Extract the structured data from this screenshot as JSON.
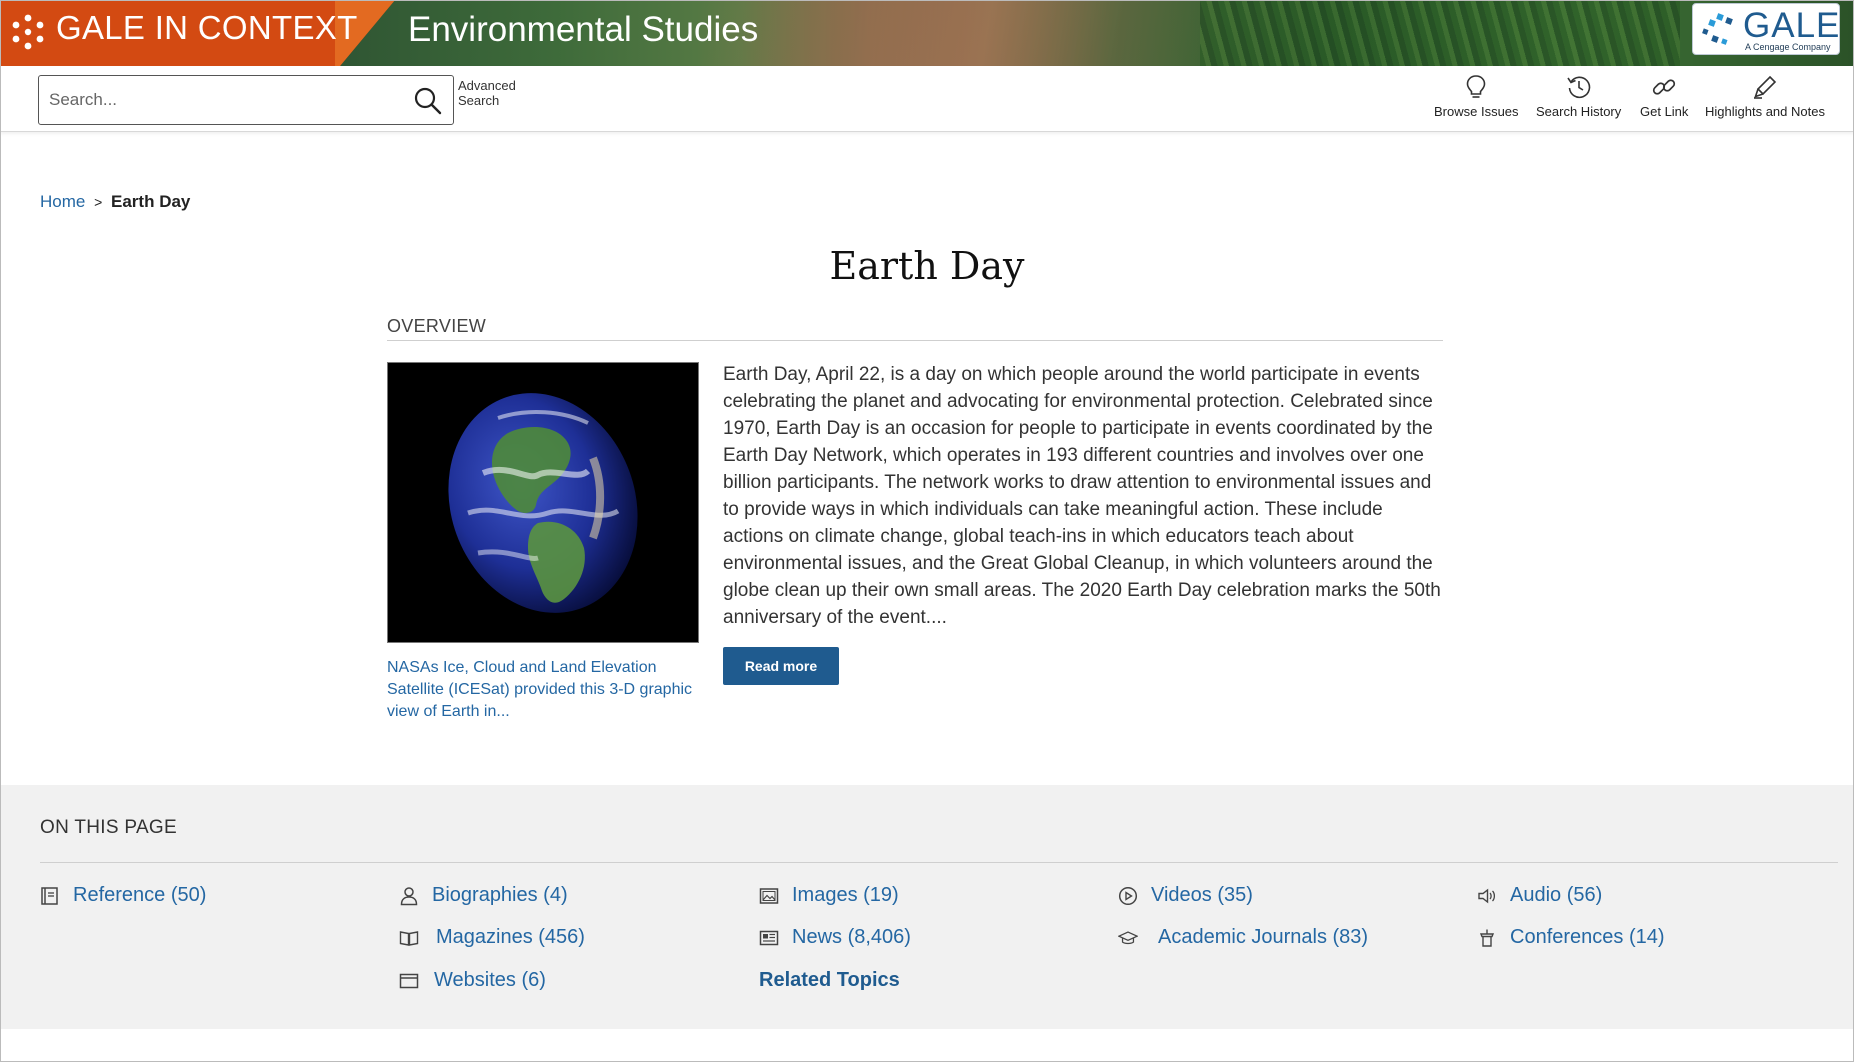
{
  "header": {
    "brand": "GALE IN CONTEXT",
    "product": "Environmental Studies",
    "publisher_logo": "GALE",
    "publisher_tagline": "A Cengage Company"
  },
  "toolbar": {
    "search_placeholder": "Search...",
    "advanced_search": "Advanced Search",
    "tools": [
      {
        "label": "Browse Issues",
        "icon": "lightbulb-icon"
      },
      {
        "label": "Search History",
        "icon": "history-icon"
      },
      {
        "label": "Get Link",
        "icon": "link-icon"
      },
      {
        "label": "Highlights and Notes",
        "icon": "highlighter-icon"
      }
    ]
  },
  "breadcrumb": {
    "home": "Home",
    "separator": ">",
    "current": "Earth Day"
  },
  "page": {
    "title": "Earth Day",
    "overview_label": "OVERVIEW",
    "image_caption": "NASAs Ice, Cloud and Land Elevation Satellite (ICESat) provided this 3-D graphic view of Earth in...",
    "overview_text": "Earth Day, April 22, is a day on which people around the world participate in events celebrating the planet and advocating for environmental protection. Celebrated since 1970, Earth Day is an occasion for people to participate in events coordinated by the Earth Day Network, which operates in 193 different countries and involves over one billion participants. The network works to draw attention to environmental issues and to provide ways in which individuals can take meaningful action. These include actions on climate change, global teach-ins in which educators teach about environmental issues, and the Great Global Cleanup, in which volunteers around the globe clean up their own small areas. The 2020 Earth Day celebration marks the 50th anniversary of the event....",
    "read_more": "Read more"
  },
  "on_this_page": {
    "title": "ON THIS PAGE",
    "items": [
      {
        "label": "Reference (50)",
        "icon": "reference-icon"
      },
      {
        "label": "Biographies (4)",
        "icon": "person-icon"
      },
      {
        "label": "Images (19)",
        "icon": "image-icon"
      },
      {
        "label": "Videos (35)",
        "icon": "play-icon"
      },
      {
        "label": "Audio (56)",
        "icon": "speaker-icon"
      },
      {
        "label": "Magazines (456)",
        "icon": "open-book-icon"
      },
      {
        "label": "News (8,406)",
        "icon": "newspaper-icon"
      },
      {
        "label": "Academic Journals (83)",
        "icon": "graduation-cap-icon"
      },
      {
        "label": "Conferences (14)",
        "icon": "podium-icon"
      },
      {
        "label": "Websites (6)",
        "icon": "browser-window-icon"
      }
    ],
    "related_topics": "Related Topics"
  },
  "colors": {
    "brand_orange": "#d34a12",
    "link_blue": "#2467a3",
    "button_blue": "#1f5b8f",
    "section_gray": "#f1f1f1"
  }
}
